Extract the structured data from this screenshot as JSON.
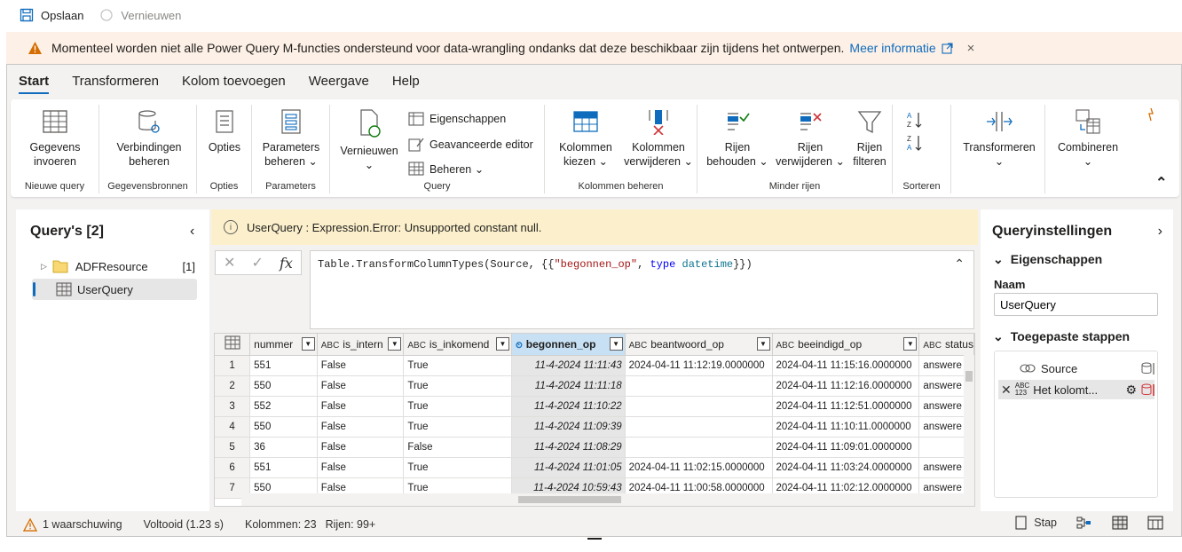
{
  "topbar": {
    "save_label": "Opslaan",
    "refresh_label": "Vernieuwen"
  },
  "banner": {
    "message": "Momenteel worden niet alle Power Query M-functies ondersteund voor data-wrangling ondanks dat deze beschikbaar zijn tijdens het ontwerpen.",
    "link": "Meer informatie",
    "close": "×"
  },
  "tabs": [
    "Start",
    "Transformeren",
    "Kolom toevoegen",
    "Weergave",
    "Help"
  ],
  "ribbon": {
    "groups": {
      "nieuwe_query": "Nieuwe query",
      "gegevensbronnen": "Gegevensbronnen",
      "opties": "Opties",
      "parameters": "Parameters",
      "query": "Query",
      "kolommen_beheren": "Kolommen beheren",
      "minder_rijen": "Minder rijen",
      "sorteren": "Sorteren"
    },
    "buttons": {
      "gegevens_invoeren": [
        "Gegevens",
        "invoeren"
      ],
      "verbindingen_beheren": [
        "Verbindingen",
        "beheren"
      ],
      "opties": "Opties",
      "parameters_beheren": [
        "Parameters",
        "beheren ⌄"
      ],
      "vernieuwen": "Vernieuwen",
      "eigenschappen": "Eigenschappen",
      "geavanceerde_editor": "Geavanceerde editor",
      "beheren": "Beheren ⌄",
      "kolommen_kiezen": [
        "Kolommen",
        "kiezen ⌄"
      ],
      "kolommen_verwijderen": [
        "Kolommen",
        "verwijderen ⌄"
      ],
      "rijen_behouden": [
        "Rijen",
        "behouden ⌄"
      ],
      "rijen_verwijderen": [
        "Rijen",
        "verwijderen ⌄"
      ],
      "rijen_filteren": [
        "Rijen",
        "filteren"
      ],
      "transformeren": "Transformeren",
      "combineren": "Combineren"
    }
  },
  "queries": {
    "title": "Query's [2]",
    "items": [
      {
        "label": "ADFResource",
        "count": "[1]"
      },
      {
        "label": "UserQuery"
      }
    ]
  },
  "error": {
    "text": "UserQuery : Expression.Error: Unsupported constant null."
  },
  "formula": {
    "prefix": "Table.TransformColumnTypes(Source, {{",
    "string": "\"begonnen_op\"",
    "mid": ", ",
    "keyword": "type",
    "type": "datetime",
    "suffix": "}})"
  },
  "grid": {
    "columns": [
      {
        "label": "nummer",
        "type": ""
      },
      {
        "label": "is_intern",
        "type": "ABC"
      },
      {
        "label": "is_inkomend",
        "type": "ABC"
      },
      {
        "label": "begonnen_op",
        "type": "⏲"
      },
      {
        "label": "beantwoord_op",
        "type": "ABC"
      },
      {
        "label": "beeindigd_op",
        "type": "ABC"
      },
      {
        "label": "status",
        "type": "ABC"
      }
    ],
    "rows": [
      [
        "1",
        "551",
        "False",
        "True",
        "11-4-2024 11:11:43",
        "2024-04-11 11:12:19.0000000",
        "2024-04-11 11:15:16.0000000",
        "answere"
      ],
      [
        "2",
        "550",
        "False",
        "True",
        "11-4-2024 11:11:18",
        "",
        "2024-04-11 11:12:16.0000000",
        "answere"
      ],
      [
        "3",
        "552",
        "False",
        "True",
        "11-4-2024 11:10:22",
        "",
        "2024-04-11 11:12:51.0000000",
        "answere"
      ],
      [
        "4",
        "550",
        "False",
        "True",
        "11-4-2024 11:09:39",
        "",
        "2024-04-11 11:10:11.0000000",
        "answere"
      ],
      [
        "5",
        "36",
        "False",
        "False",
        "11-4-2024 11:08:29",
        "",
        "2024-04-11 11:09:01.0000000",
        ""
      ],
      [
        "6",
        "551",
        "False",
        "True",
        "11-4-2024 11:01:05",
        "2024-04-11 11:02:15.0000000",
        "2024-04-11 11:03:24.0000000",
        "answere"
      ],
      [
        "7",
        "550",
        "False",
        "True",
        "11-4-2024 10:59:43",
        "2024-04-11 11:00:58.0000000",
        "2024-04-11 11:02:12.0000000",
        "answere"
      ]
    ]
  },
  "settings": {
    "title": "Queryinstellingen",
    "properties": "Eigenschappen",
    "name_label": "Naam",
    "name_value": "UserQuery",
    "steps_title": "Toegepaste stappen",
    "steps": [
      "Source",
      "Het kolomt..."
    ]
  },
  "status": {
    "warnings": "1 waarschuwing",
    "done": "Voltooid (1.23 s)",
    "columns": "Kolommen: 23",
    "rows": "Rijen: 99+",
    "step": "Stap"
  }
}
